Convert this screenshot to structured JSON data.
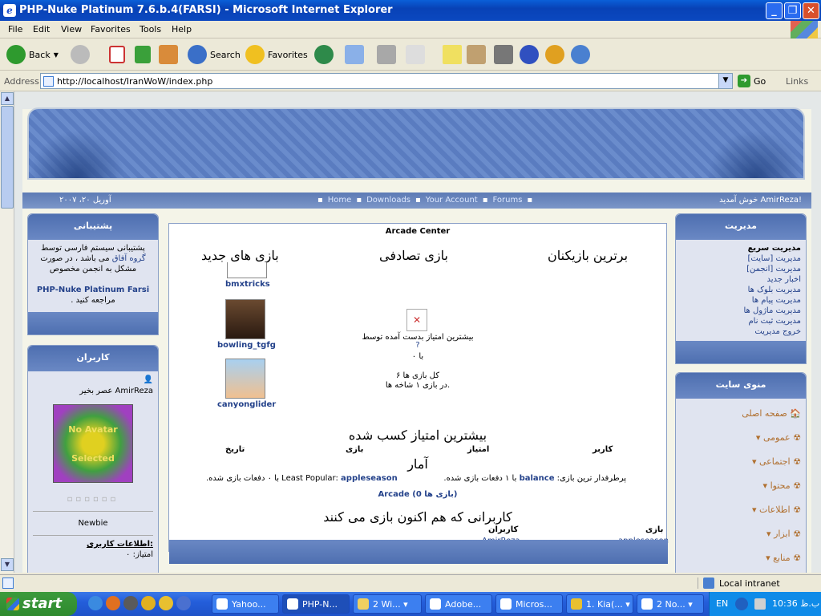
{
  "window": {
    "title": "PHP-Nuke Platinum 7.6.b.4(FARSI) - Microsoft Internet Explorer",
    "min": "_",
    "max": "❐",
    "close": "✕"
  },
  "menu": [
    "File",
    "Edit",
    "View",
    "Favorites",
    "Tools",
    "Help"
  ],
  "toolbar": {
    "back": "Back",
    "search": "Search",
    "favorites": "Favorites"
  },
  "address": {
    "label": "Address",
    "url": "http://localhost/IranWoW/index.php",
    "go": "Go",
    "links": "Links"
  },
  "nav": {
    "date": "آوریل ۲۰، ۲۰۰۷",
    "welcome": "خوش آمدید AmirReza!",
    "links": [
      "Home",
      "Downloads",
      "Your Account",
      "Forums"
    ]
  },
  "left": {
    "support_title": "پشتیبانی",
    "support_text1": "پشتیبانی سیستم فارسی توسط",
    "support_link": "گروه آفاق",
    "support_text2": "می باشد ، در صورت مشکل به انجمن مخصوص",
    "support_product": "PHP-Nuke Platinum Farsi",
    "support_text3": "مراجعه کنید .",
    "users_title": "کاربران",
    "greeting": "عصر بخیر AmirReza",
    "avatar_line1": "No Avatar",
    "avatar_line2": "Selected",
    "rank": "Newbie",
    "user_info": "اطلاعات کاربری:",
    "points": "امتیاز: ۰"
  },
  "center": {
    "title": "Arcade Center",
    "col_top_players": "برترین بازیکنان",
    "col_random": "بازی تصادفی",
    "col_new": "بازی های جدید",
    "games": [
      "bmxtricks",
      "bowling_tgfg",
      "canyonglider"
    ],
    "highscore_by": "بیشترین امتیاز بدست آمده توسط",
    "with": "با ۰",
    "total_games": "کل بازی ها ۶",
    "in_category": "در بازی ۱ شاخه ها.",
    "top_score_header": "بیشترین امتیاز کسب شده",
    "table_headers": [
      "کاربر",
      "امتیاز",
      "بازی",
      "تاریخ"
    ],
    "stats_header": "آمار",
    "stats_most_label": "پرطرفدار ترین بازی:",
    "stats_most_game": "balance",
    "stats_most_rest": "با ۱ دفعات بازی شده.",
    "stats_least_label": "Least Popular:",
    "stats_least_game": "appleseason",
    "stats_least_rest": "با ۰ دفعات بازی شده.",
    "arcade_link": "Arcade (0 بازی ها)",
    "playing_now": "کاربرانی که هم اکنون بازی می کنند",
    "playing_headers": [
      "بازی",
      "کاربران"
    ],
    "playing_game": "appleseason",
    "playing_user": "AmirReza"
  },
  "right": {
    "admin_title": "مدیریت",
    "quick_admin": "مدیریت سریع",
    "admin_items": [
      "مدیریت [سایت]",
      "مدیریت [انجمن]",
      "اخبار جدید",
      "مدیریت بلوک ها",
      "مدیریت پیام ها",
      "مدیریت ماژول ها",
      "مدیریت ثبت نام",
      "خروج مدیریت"
    ],
    "menu_title": "منوی سایت",
    "menu_items": [
      "صفحه اصلی",
      "عمومی",
      "اجتماعی",
      "محتوا",
      "اطلاعات",
      "ابزار",
      "منابع"
    ]
  },
  "status": {
    "zone": "Local intranet"
  },
  "taskbar": {
    "start": "start",
    "tasks": [
      "Yahoo...",
      "PHP-N...",
      "2 Wi...",
      "Adobe...",
      "Micros...",
      "1. Kia(...",
      "2 No..."
    ],
    "lang": "EN",
    "time": "10:36 ب.ظ"
  }
}
